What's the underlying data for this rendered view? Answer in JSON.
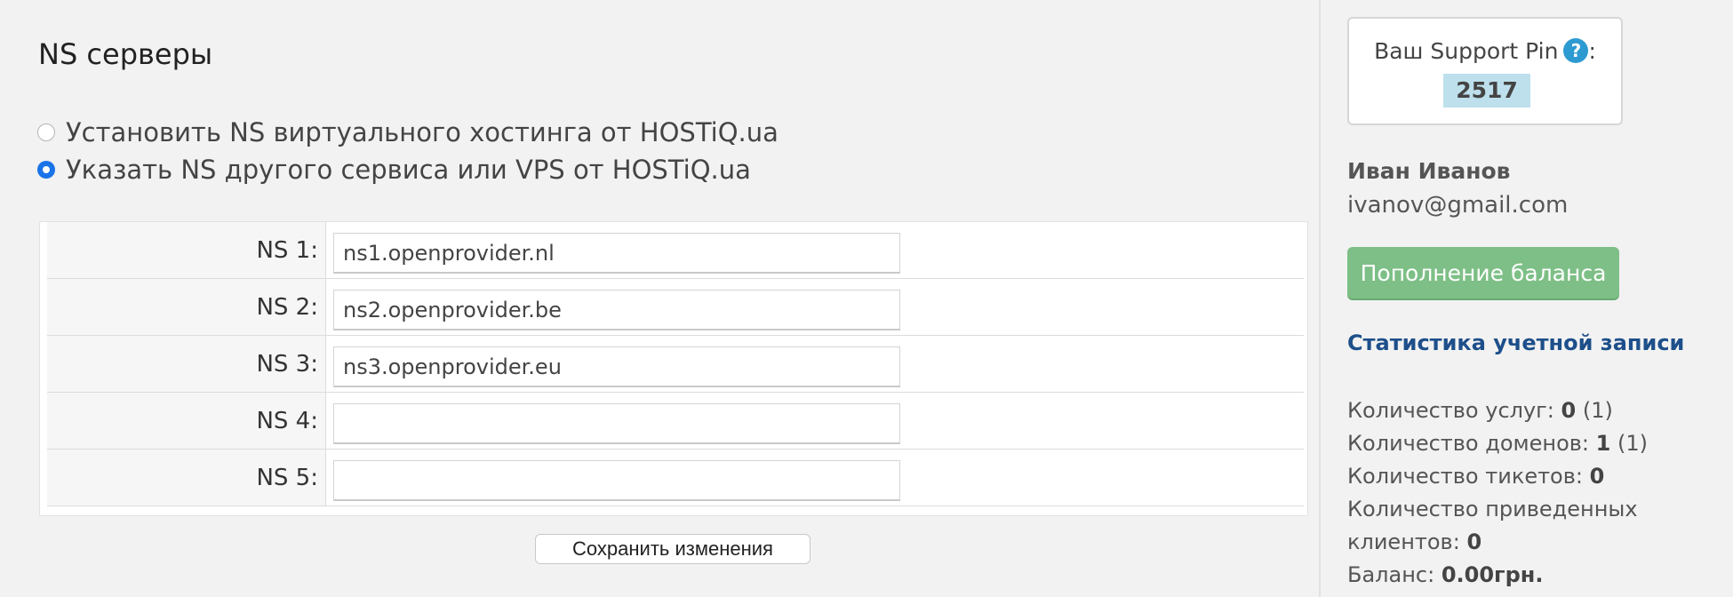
{
  "main": {
    "title": "NS серверы",
    "radio_options": [
      {
        "label": "Установить NS виртуального хостинга от HOSTiQ.ua",
        "checked": false
      },
      {
        "label": "Указать NS другого сервиса или VPS от HOSTiQ.ua",
        "checked": true
      }
    ],
    "ns_rows": [
      {
        "label": "NS 1:",
        "value": "ns1.openprovider.nl"
      },
      {
        "label": "NS 2:",
        "value": "ns2.openprovider.be"
      },
      {
        "label": "NS 3:",
        "value": "ns3.openprovider.eu"
      },
      {
        "label": "NS 4:",
        "value": ""
      },
      {
        "label": "NS 5:",
        "value": ""
      }
    ],
    "save_label": "Сохранить изменения"
  },
  "sidebar": {
    "support_pin_label": "Ваш Support Pin",
    "support_pin_colon": ":",
    "help_icon_glyph": "?",
    "support_pin": "2517",
    "user_name": "Иван Иванов",
    "user_email": "ivanov@gmail.com",
    "topup_label": "Пополнение баланса",
    "stats_title": "Статистика учетной записи",
    "stats": {
      "services_label": "Количество услуг:",
      "services_value": "0",
      "services_extra": "(1)",
      "domains_label": "Количество доменов:",
      "domains_value": "1",
      "domains_extra": "(1)",
      "tickets_label": "Количество тикетов:",
      "tickets_value": "0",
      "referred_label": "Количество приведенных клиентов:",
      "referred_value": "0",
      "balance_label": "Баланс:",
      "balance_value": "0.00грн."
    }
  },
  "colors": {
    "accent": "#1a73e8",
    "button_green": "#7dbf86",
    "stats_title": "#1d4f8a",
    "pin_highlight": "#bde0ec",
    "help_icon": "#2d9ad2"
  }
}
